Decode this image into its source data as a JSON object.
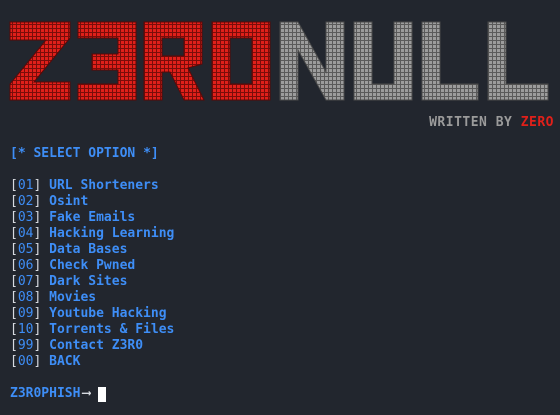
{
  "banner": {
    "text": "Z3R0NULL",
    "red_part": "Z3R0",
    "gray_part": "NULL",
    "red_color": "#e0201a",
    "gray_color": "#9c9c9c"
  },
  "byline": {
    "prefix": "WRITTEN BY ",
    "author": "ZERO"
  },
  "header": {
    "open": "[*",
    "title": "SELECT OPTION",
    "close": "*]"
  },
  "menu": [
    {
      "num": "01",
      "label": "URL Shorteners"
    },
    {
      "num": "02",
      "label": "Osint"
    },
    {
      "num": "03",
      "label": "Fake Emails"
    },
    {
      "num": "04",
      "label": "Hacking Learning"
    },
    {
      "num": "05",
      "label": "Data Bases"
    },
    {
      "num": "06",
      "label": "Check Pwned"
    },
    {
      "num": "07",
      "label": "Dark Sites"
    },
    {
      "num": "08",
      "label": "Movies"
    },
    {
      "num": "09",
      "label": "Youtube Hacking"
    },
    {
      "num": "10",
      "label": "Torrents & Files"
    },
    {
      "num": "99",
      "label": "Contact Z3R0"
    },
    {
      "num": "00",
      "label": "BACK"
    }
  ],
  "prompt": {
    "label": "Z3R0PHISH",
    "arrow": "⟶"
  },
  "colors": {
    "background": "#22262e",
    "accent_blue": "#3e8ef7",
    "text": "#d7dae0"
  }
}
